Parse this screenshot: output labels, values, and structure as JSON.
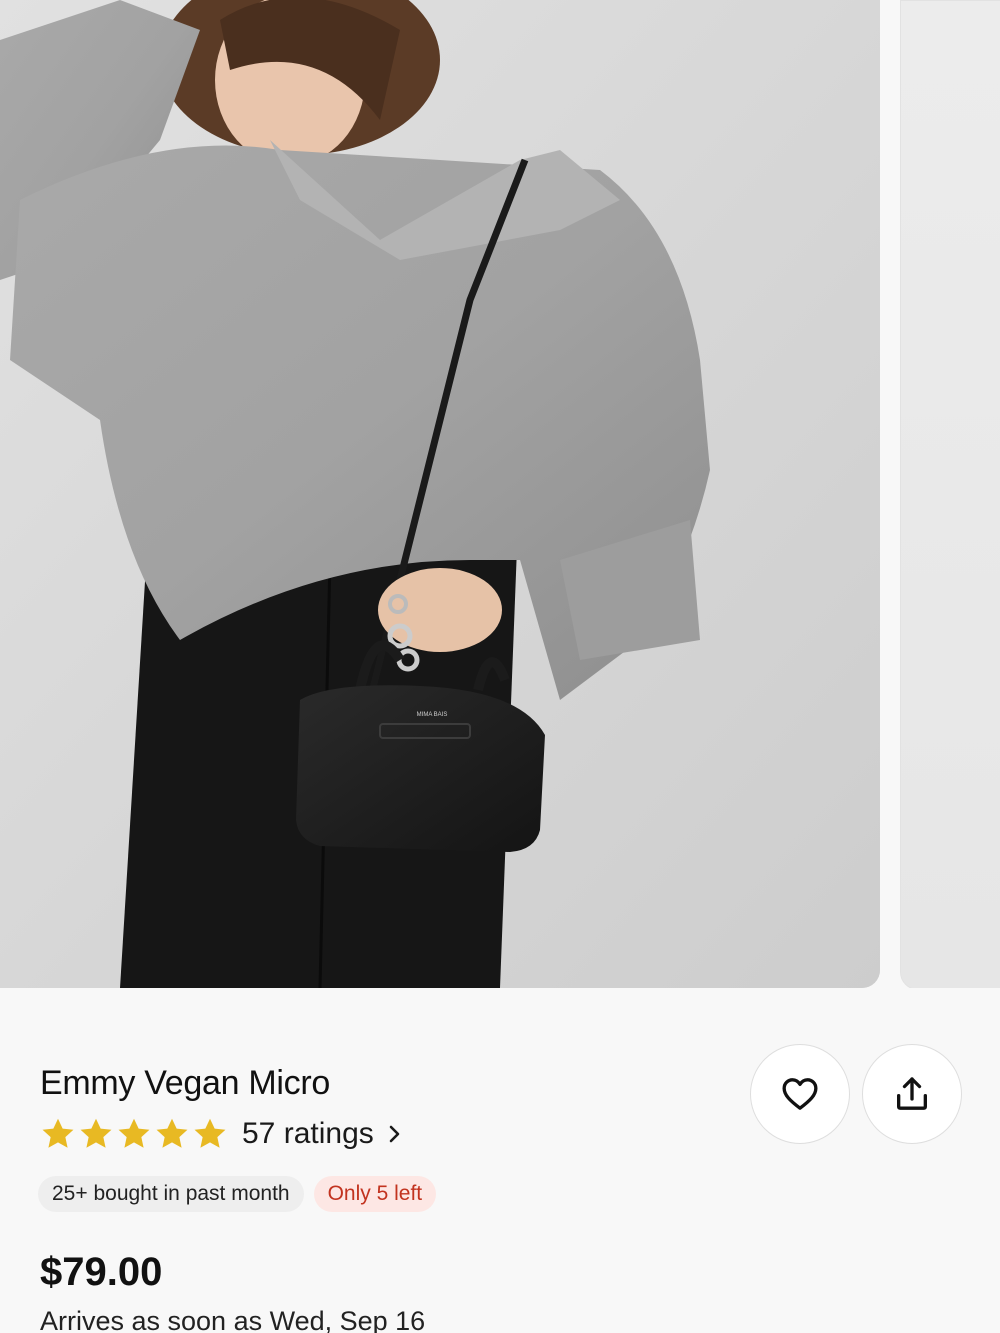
{
  "product": {
    "title": "Emmy Vegan Micro",
    "rating": 5,
    "ratings_label": "57 ratings",
    "badges": {
      "bought": "25+ bought in past month",
      "stock": "Only 5 left"
    },
    "price": "$79.00",
    "delivery": "Arrives as soon as Wed, Sep 16"
  },
  "bag_logo": "MIMA BAIS",
  "icons": {
    "favorite": "heart-icon",
    "share": "share-upload-icon",
    "star": "star-icon",
    "chevron": "chevron-right-icon"
  },
  "colors": {
    "star": "#E8B923",
    "stock_text": "#C2331F",
    "stock_bg": "#FDE7E4",
    "badge_bg": "#EEEEEE",
    "page_bg": "#F8F8F8"
  },
  "carousel": {
    "current_slide": 1
  }
}
